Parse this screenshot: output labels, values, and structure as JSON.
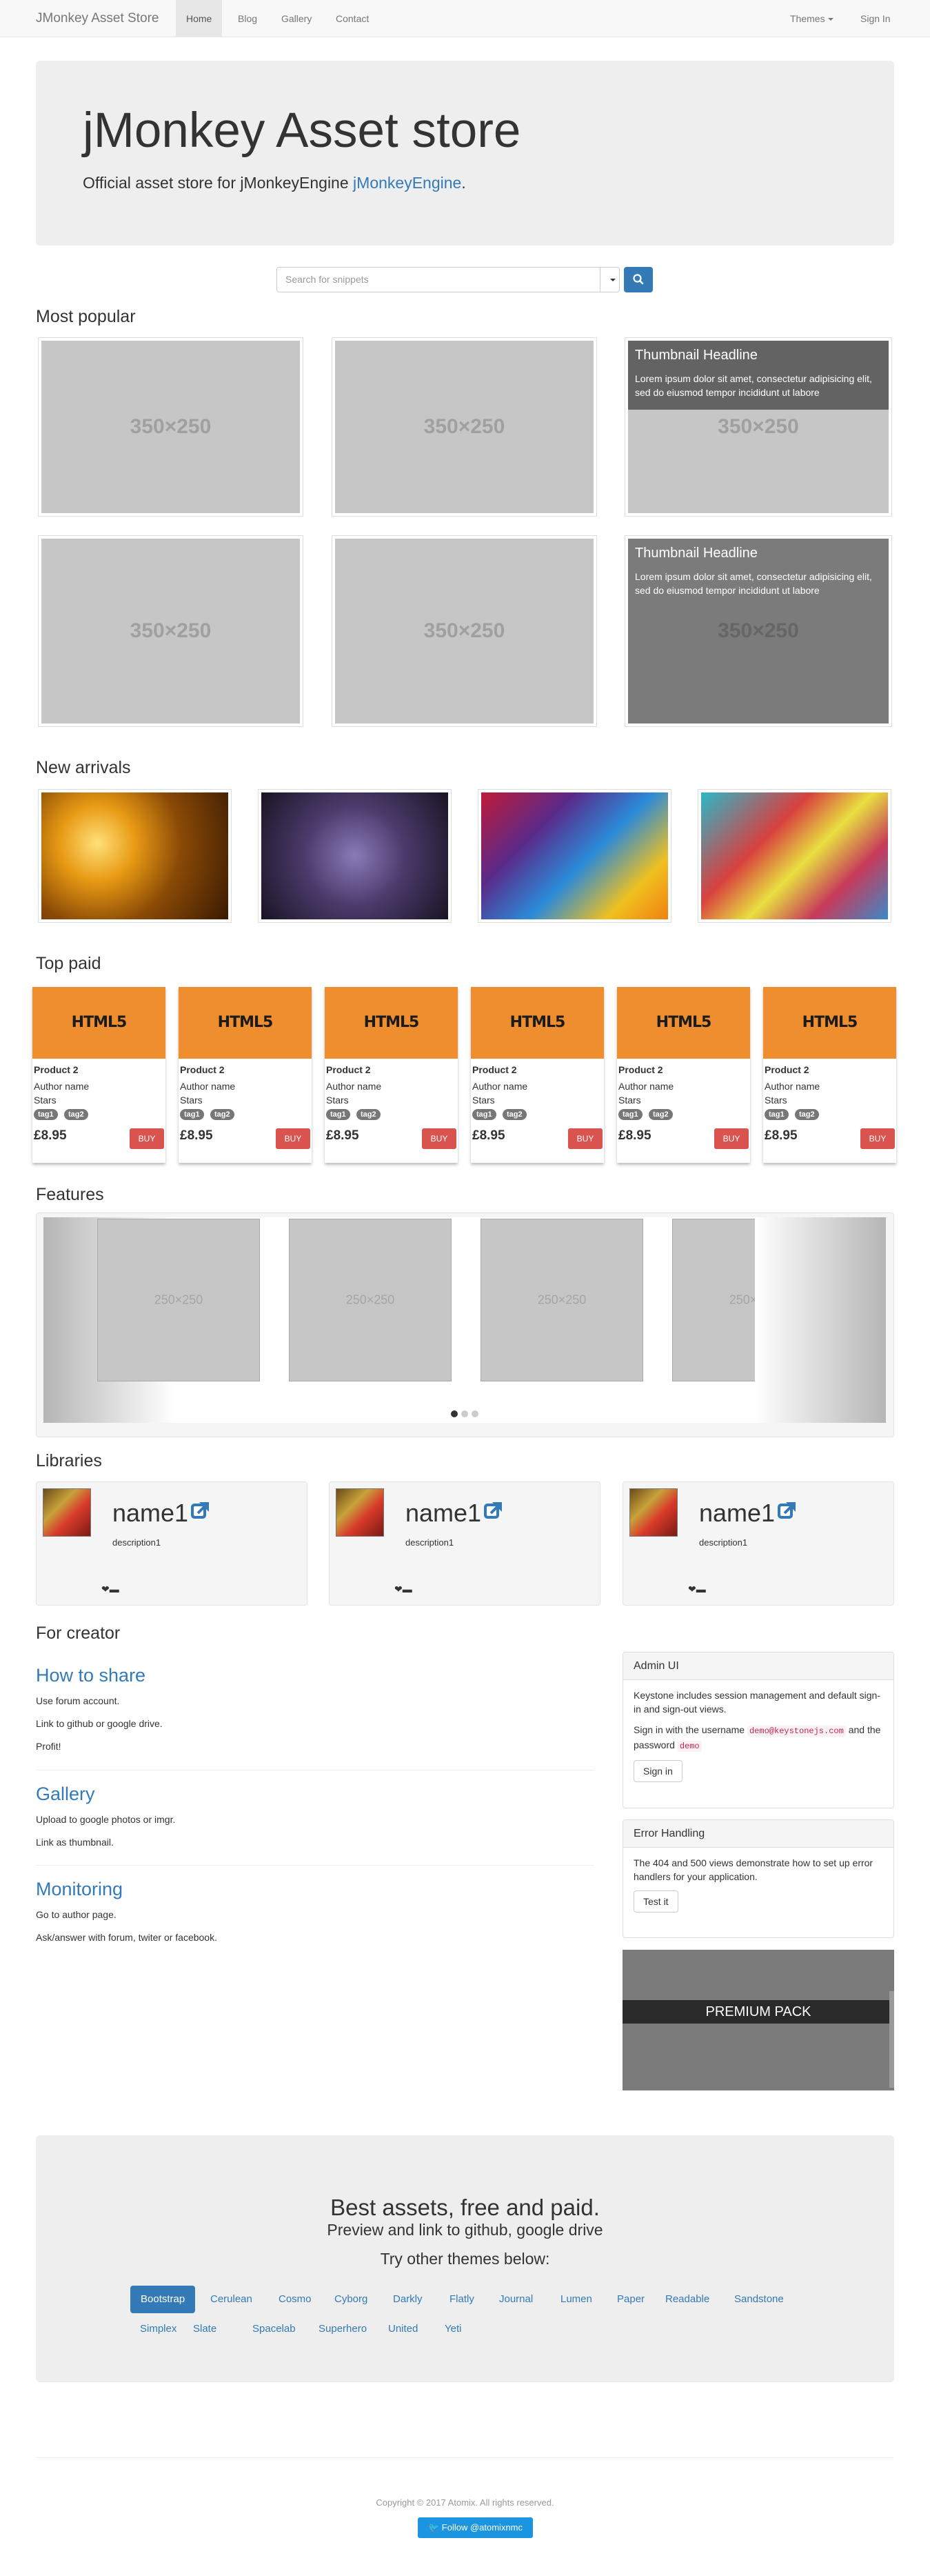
{
  "navbar": {
    "brand": "JMonkey Asset Store",
    "links": [
      "Home",
      "Blog",
      "Gallery",
      "Contact"
    ],
    "right": {
      "themes": "Themes",
      "signin": "Sign In"
    }
  },
  "hero": {
    "title": "jMonkey Asset store",
    "subtitle": "Official asset store for jMonkeyEngine ",
    "subtitle_link": "jMonkeyEngine",
    "subtitle_end": "."
  },
  "search": {
    "placeholder": "Search for snippets"
  },
  "popular": {
    "heading": "Most popular",
    "placeholder_label": "350×250",
    "caption_title": "Thumbnail Headline",
    "caption_text": "Lorem ipsum dolor sit amet, consectetur adipisicing elit, sed do eiusmod tempor incididunt ut labore"
  },
  "new_arrivals": {
    "heading": "New arrivals"
  },
  "top_paid": {
    "heading": "Top paid",
    "items": [
      {
        "banner": "HTML5",
        "name": "Product 2",
        "author": "Author name",
        "stars": "Stars",
        "tags": [
          "tag1",
          "tag2"
        ],
        "price": "£8.95",
        "buy": "BUY"
      },
      {
        "banner": "HTML5",
        "name": "Product 2",
        "author": "Author name",
        "stars": "Stars",
        "tags": [
          "tag1",
          "tag2"
        ],
        "price": "£8.95",
        "buy": "BUY"
      },
      {
        "banner": "HTML5",
        "name": "Product 2",
        "author": "Author name",
        "stars": "Stars",
        "tags": [
          "tag1",
          "tag2"
        ],
        "price": "£8.95",
        "buy": "BUY"
      },
      {
        "banner": "HTML5",
        "name": "Product 2",
        "author": "Author name",
        "stars": "Stars",
        "tags": [
          "tag1",
          "tag2"
        ],
        "price": "£8.95",
        "buy": "BUY"
      },
      {
        "banner": "HTML5",
        "name": "Product 2",
        "author": "Author name",
        "stars": "Stars",
        "tags": [
          "tag1",
          "tag2"
        ],
        "price": "£8.95",
        "buy": "BUY"
      },
      {
        "banner": "HTML5",
        "name": "Product 2",
        "author": "Author name",
        "stars": "Stars",
        "tags": [
          "tag1",
          "tag2"
        ],
        "price": "£8.95",
        "buy": "BUY"
      }
    ]
  },
  "features": {
    "heading": "Features",
    "placeholder_label": "250×250"
  },
  "libraries": {
    "heading": "Libraries",
    "items": [
      {
        "name": "name1",
        "description": "description1"
      },
      {
        "name": "name1",
        "description": "description1"
      },
      {
        "name": "name1",
        "description": "description1"
      }
    ]
  },
  "creator": {
    "heading": "For creator",
    "sections": [
      {
        "title": "How to share",
        "lines": [
          "Use forum account.",
          "Link to github or google drive.",
          "Profit!"
        ]
      },
      {
        "title": "Gallery",
        "lines": [
          "Upload to google photos or imgr.",
          "Link as thumbnail."
        ]
      },
      {
        "title": "Monitoring",
        "lines": [
          "Go to author page.",
          "Ask/answer with forum, twiter or facebook."
        ]
      }
    ]
  },
  "admin_panel": {
    "title": "Admin UI",
    "text1": "Keystone includes session management and default sign-in and sign-out views.",
    "text2a": "Sign in with the username ",
    "email": "demo@keystonejs.com",
    "text2b": " and the password ",
    "password": "demo",
    "button": "Sign in"
  },
  "error_panel": {
    "title": "Error Handling",
    "text": "The 404 and 500 views demonstrate how to set up error handlers for your application.",
    "button": "Test it"
  },
  "premium": {
    "label": "PREMIUM PACK"
  },
  "bottom": {
    "title": "Best assets, free and paid.",
    "subtitle": "Preview and link to github, google drive",
    "themes_label": "Try other themes below:",
    "themes_row1": [
      "Bootstrap",
      "Cerulean",
      "Cosmo",
      "Cyborg",
      "Darkly",
      "Flatly",
      "Journal",
      "Lumen",
      "Paper",
      "Readable",
      "Sandstone"
    ],
    "themes_row2": [
      "Simplex",
      "Slate",
      "Spacelab",
      "Superhero",
      "United",
      "Yeti"
    ]
  },
  "footer": {
    "copyright": "Copyright © 2017 Atomix. All rights reserved.",
    "twitter": "Follow @atomixnmc"
  }
}
